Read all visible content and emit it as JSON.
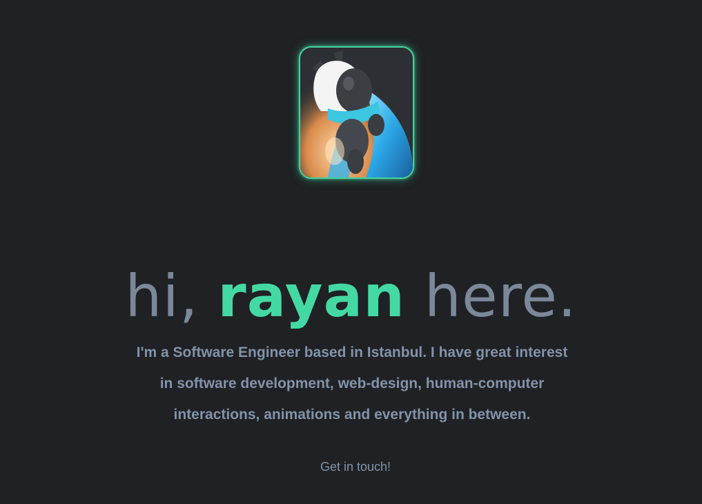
{
  "hero": {
    "greeting_prefix": "hi,",
    "name": "rayan",
    "greeting_suffix": "here.",
    "bio": "I'm a Software Engineer based in Istanbul. I have great interest in software development, web-design, human-computer interactions, animations and everything in between.",
    "cta_label": "Get in touch!"
  },
  "colors": {
    "background": "#1f2124",
    "accent": "#44d9a3",
    "headline_text": "#7b889a",
    "body_text": "#8293aa"
  }
}
